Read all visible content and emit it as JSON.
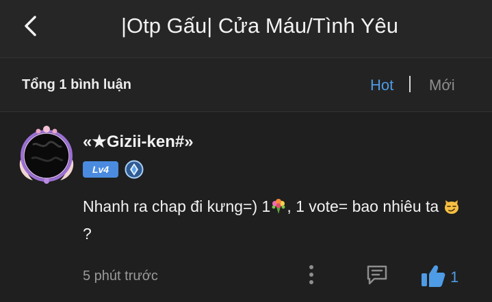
{
  "header": {
    "back_icon": "chevron-left-icon",
    "title": "|Otp Gấu| Cửa Máu/Tình Yêu"
  },
  "sortbar": {
    "total": "Tổng 1 bình luận",
    "hot_label": "Hot",
    "separator": "|",
    "new_label": "Mới",
    "active": "Hot",
    "active_color": "#4e9be6",
    "inactive_color": "#8e8e8e"
  },
  "comment": {
    "username": "«★Gizii-ken#»",
    "level": "Lv4",
    "rank_icon": "diamond-rank-icon",
    "text_part1": "Nhanh ra chap đi kưng=) 1",
    "text_part2": ", 1 vote= bao nhiêu ta ",
    "text_part3": "?",
    "emojis": [
      "bouquet-emoji",
      "smirking-cat-emoji"
    ],
    "time": "5 phút trước",
    "like_count": "1",
    "actions": [
      "more-icon",
      "comment-icon",
      "thumbs-up-icon"
    ]
  },
  "colors": {
    "background": "#1f1f1f",
    "header_bg": "#262626",
    "accent": "#4e9be6",
    "badge": "#4a8be0"
  }
}
